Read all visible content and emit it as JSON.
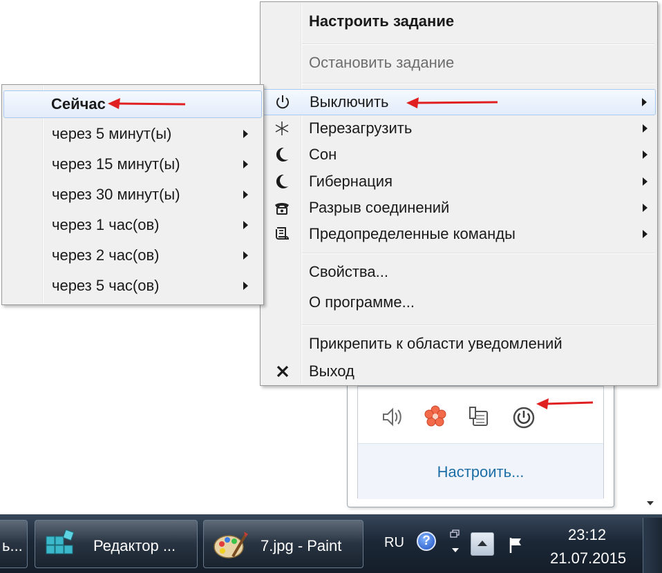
{
  "main_menu": {
    "items": [
      {
        "label": "Настроить задание",
        "bold": true
      },
      {
        "label": "Остановить задание",
        "disabled": true
      },
      {
        "label": "Выключить",
        "icon": "power-icon",
        "submenu": true,
        "highlighted": true
      },
      {
        "label": "Перезагрузить",
        "icon": "restart-icon",
        "submenu": true
      },
      {
        "label": "Сон",
        "icon": "moon-icon",
        "submenu": true
      },
      {
        "label": "Гибернация",
        "icon": "moon-icon",
        "submenu": true
      },
      {
        "label": "Разрыв соединений",
        "icon": "phone-icon",
        "submenu": true
      },
      {
        "label": "Предопределенные команды",
        "icon": "scroll-icon",
        "submenu": true
      },
      {
        "label": "Свойства..."
      },
      {
        "label": "О программе..."
      },
      {
        "label": "Прикрепить к области уведомлений"
      },
      {
        "label": "Выход",
        "icon": "close-icon"
      }
    ]
  },
  "sub_menu": {
    "items": [
      {
        "label": "Сейчас",
        "bold": true,
        "highlighted": true
      },
      {
        "label": "через 5 минут(ы)",
        "submenu": true
      },
      {
        "label": "через 15 минут(ы)",
        "submenu": true
      },
      {
        "label": "через 30 минут(ы)",
        "submenu": true
      },
      {
        "label": "через 1 час(ов)",
        "submenu": true
      },
      {
        "label": "через 2 час(ов)",
        "submenu": true
      },
      {
        "label": "через 5 час(ов)",
        "submenu": true
      }
    ]
  },
  "tray_popup": {
    "icons": [
      "speaker-icon",
      "flower-icon",
      "network-icon",
      "power-icon"
    ],
    "customize_link": "Настроить..."
  },
  "taskbar": {
    "left_partial": "ь...",
    "buttons": [
      {
        "label": "Редактор ...",
        "icon": "registry-editor-icon"
      },
      {
        "label": "7.jpg - Paint",
        "icon": "paint-icon"
      }
    ],
    "language": "RU",
    "help_symbol": "?",
    "time": "23:12",
    "date": "21.07.2015"
  },
  "colors": {
    "menu_bg": "#f0f0f0",
    "highlight": "#e2ecfa",
    "annotation_arrow": "#e02020",
    "link": "#1d6ea6",
    "taskbar": "#1c2837"
  }
}
